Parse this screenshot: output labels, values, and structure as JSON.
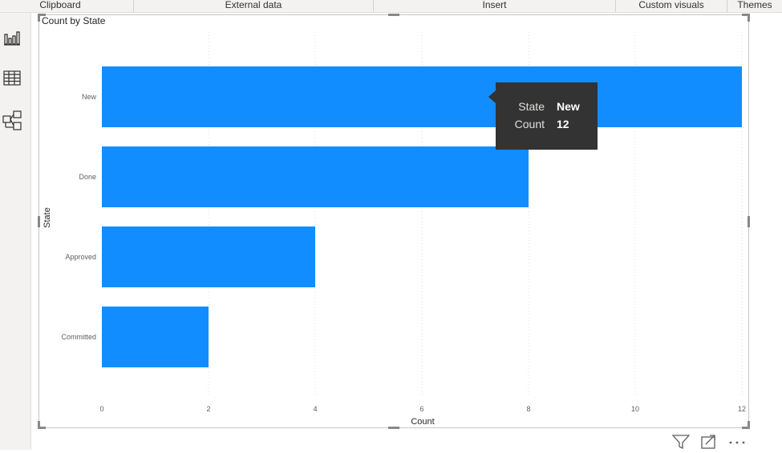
{
  "ribbon": {
    "groups": [
      {
        "label": "Clipboard"
      },
      {
        "label": "External data"
      },
      {
        "label": "Insert"
      },
      {
        "label": "Custom visuals"
      },
      {
        "label": "Themes"
      }
    ]
  },
  "left_rail": {
    "items": [
      {
        "icon": "report-view-icon"
      },
      {
        "icon": "data-view-icon"
      },
      {
        "icon": "model-view-icon"
      }
    ]
  },
  "visual": {
    "title": "Count by State"
  },
  "chart_data": {
    "type": "bar",
    "orientation": "horizontal",
    "title": "Count by State",
    "xlabel": "Count",
    "ylabel": "State",
    "categories": [
      "New",
      "Done",
      "Approved",
      "Committed"
    ],
    "values": [
      12,
      8,
      4,
      2
    ],
    "xlim": [
      0,
      12
    ],
    "x_ticks": [
      0,
      2,
      4,
      6,
      8,
      10,
      12
    ],
    "grid": "vertical-dotted",
    "bar_color": "#118dff",
    "legend": "none"
  },
  "tooltip": {
    "state_label": "State",
    "state_value": "New",
    "count_label": "Count",
    "count_value": "12"
  },
  "footer": {
    "icons": [
      "filter-icon",
      "focus-mode-icon",
      "more-options-icon"
    ]
  },
  "colors": {
    "accent": "#118dff",
    "tooltip_bg": "#333333",
    "chrome_bg": "#f3f2f1"
  }
}
